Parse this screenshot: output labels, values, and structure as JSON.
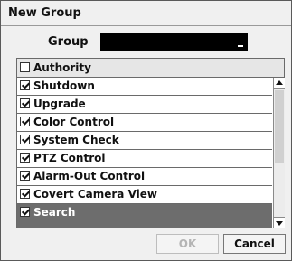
{
  "dialog": {
    "title": "New Group",
    "group_label": "Group",
    "group_value": ""
  },
  "list": {
    "header": {
      "label": "Authority",
      "checked": false
    },
    "items": [
      {
        "label": "Shutdown",
        "checked": true,
        "selected": false
      },
      {
        "label": "Upgrade",
        "checked": true,
        "selected": false
      },
      {
        "label": "Color Control",
        "checked": true,
        "selected": false
      },
      {
        "label": "System Check",
        "checked": true,
        "selected": false
      },
      {
        "label": "PTZ Control",
        "checked": true,
        "selected": false
      },
      {
        "label": "Alarm-Out Control",
        "checked": true,
        "selected": false
      },
      {
        "label": "Covert Camera View",
        "checked": true,
        "selected": false
      },
      {
        "label": "Search",
        "checked": true,
        "selected": true
      }
    ]
  },
  "buttons": {
    "ok_label": "OK",
    "cancel_label": "Cancel"
  }
}
